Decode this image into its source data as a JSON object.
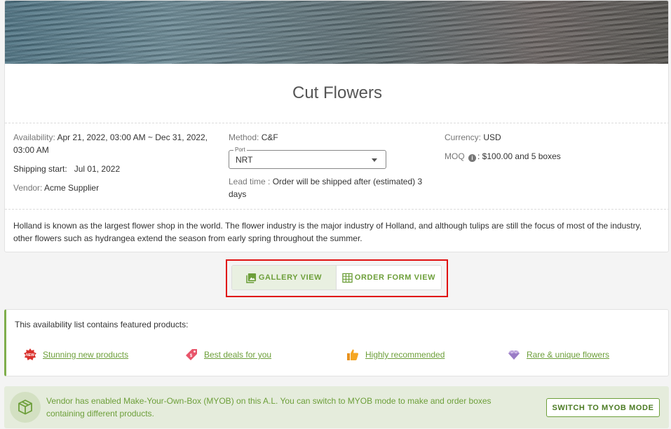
{
  "product": {
    "title": "Cut Flowers",
    "availability_label": "Availability:",
    "availability_value": "Apr 21, 2022, 03:00 AM ~ Dec 31, 2022, 03:00 AM",
    "shipping_label": "Shipping start:",
    "shipping_value": "Jul 01, 2022",
    "vendor_label": "Vendor:",
    "vendor_value": "Acme Supplier",
    "method_label": "Method:",
    "method_value": "C&F",
    "port_label": "Port",
    "port_value": "NRT",
    "lead_time_label": "Lead time :",
    "lead_time_value": "Order will be shipped after (estimated) 3 days",
    "currency_label": "Currency:",
    "currency_value": "USD",
    "moq_label": "MOQ",
    "moq_value": ": $100.00 and  5 boxes",
    "description": "Holland is known as the largest flower shop in the world. The flower industry is the major industry of Holland, and although tulips are still the focus of most of the industry, other flowers such as hydrangea extend the season from early spring throughout the summer."
  },
  "view_toggle": {
    "gallery_label": "GALLERY VIEW",
    "order_form_label": "ORDER FORM VIEW",
    "selected": "gallery"
  },
  "featured": {
    "intro": "This availability list contains featured products:",
    "items": [
      {
        "label": "Stunning new products",
        "icon": "new-badge-icon"
      },
      {
        "label": "Best deals for you",
        "icon": "price-tag-icon"
      },
      {
        "label": "Highly recommended",
        "icon": "thumbs-up-icon"
      },
      {
        "label": "Rare & unique flowers",
        "icon": "diamond-icon"
      }
    ]
  },
  "myob": {
    "message": "Vendor has enabled Make-Your-Own-Box (MYOB) on this A.L. You can switch to MYOB mode to make and order boxes containing different products.",
    "button_label": "SWITCH TO MYOB MODE"
  },
  "colors": {
    "accent_green": "#6d9f3a",
    "highlight_red": "#e01010",
    "myob_bg": "#e5ecdc"
  }
}
